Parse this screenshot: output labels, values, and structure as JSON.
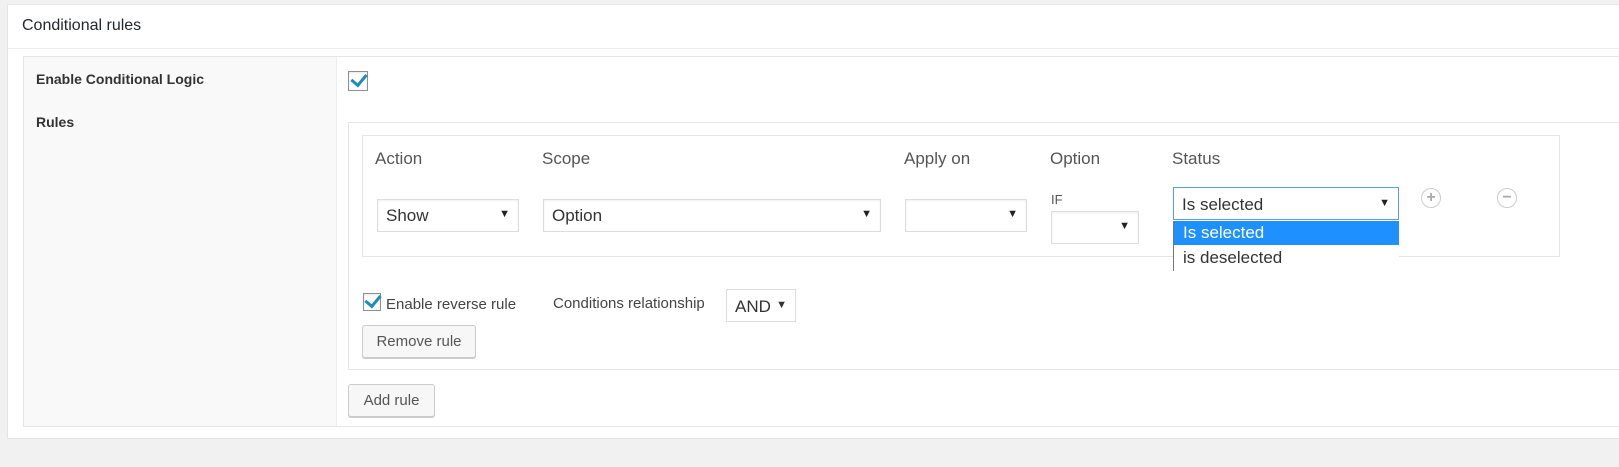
{
  "panel": {
    "title": "Conditional rules"
  },
  "settings": {
    "enable_label": "Enable Conditional Logic",
    "enable_checked": true,
    "rules_label": "Rules"
  },
  "rule": {
    "headers": {
      "action": "Action",
      "scope": "Scope",
      "apply_on": "Apply on",
      "option": "Option",
      "status": "Status"
    },
    "action_value": "Show",
    "scope_value": "Option",
    "apply_on_value": "",
    "if_label": "IF",
    "option_value": "",
    "status_value": "Is selected",
    "status_options": [
      "Is selected",
      "is deselected"
    ],
    "add_icon": "plus-icon",
    "remove_icon": "minus-icon",
    "reverse_label": "Enable reverse rule",
    "reverse_checked": true,
    "relationship_label": "Conditions relationship",
    "relationship_value": "AND",
    "remove_button": "Remove rule"
  },
  "add_rule_button": "Add rule"
}
